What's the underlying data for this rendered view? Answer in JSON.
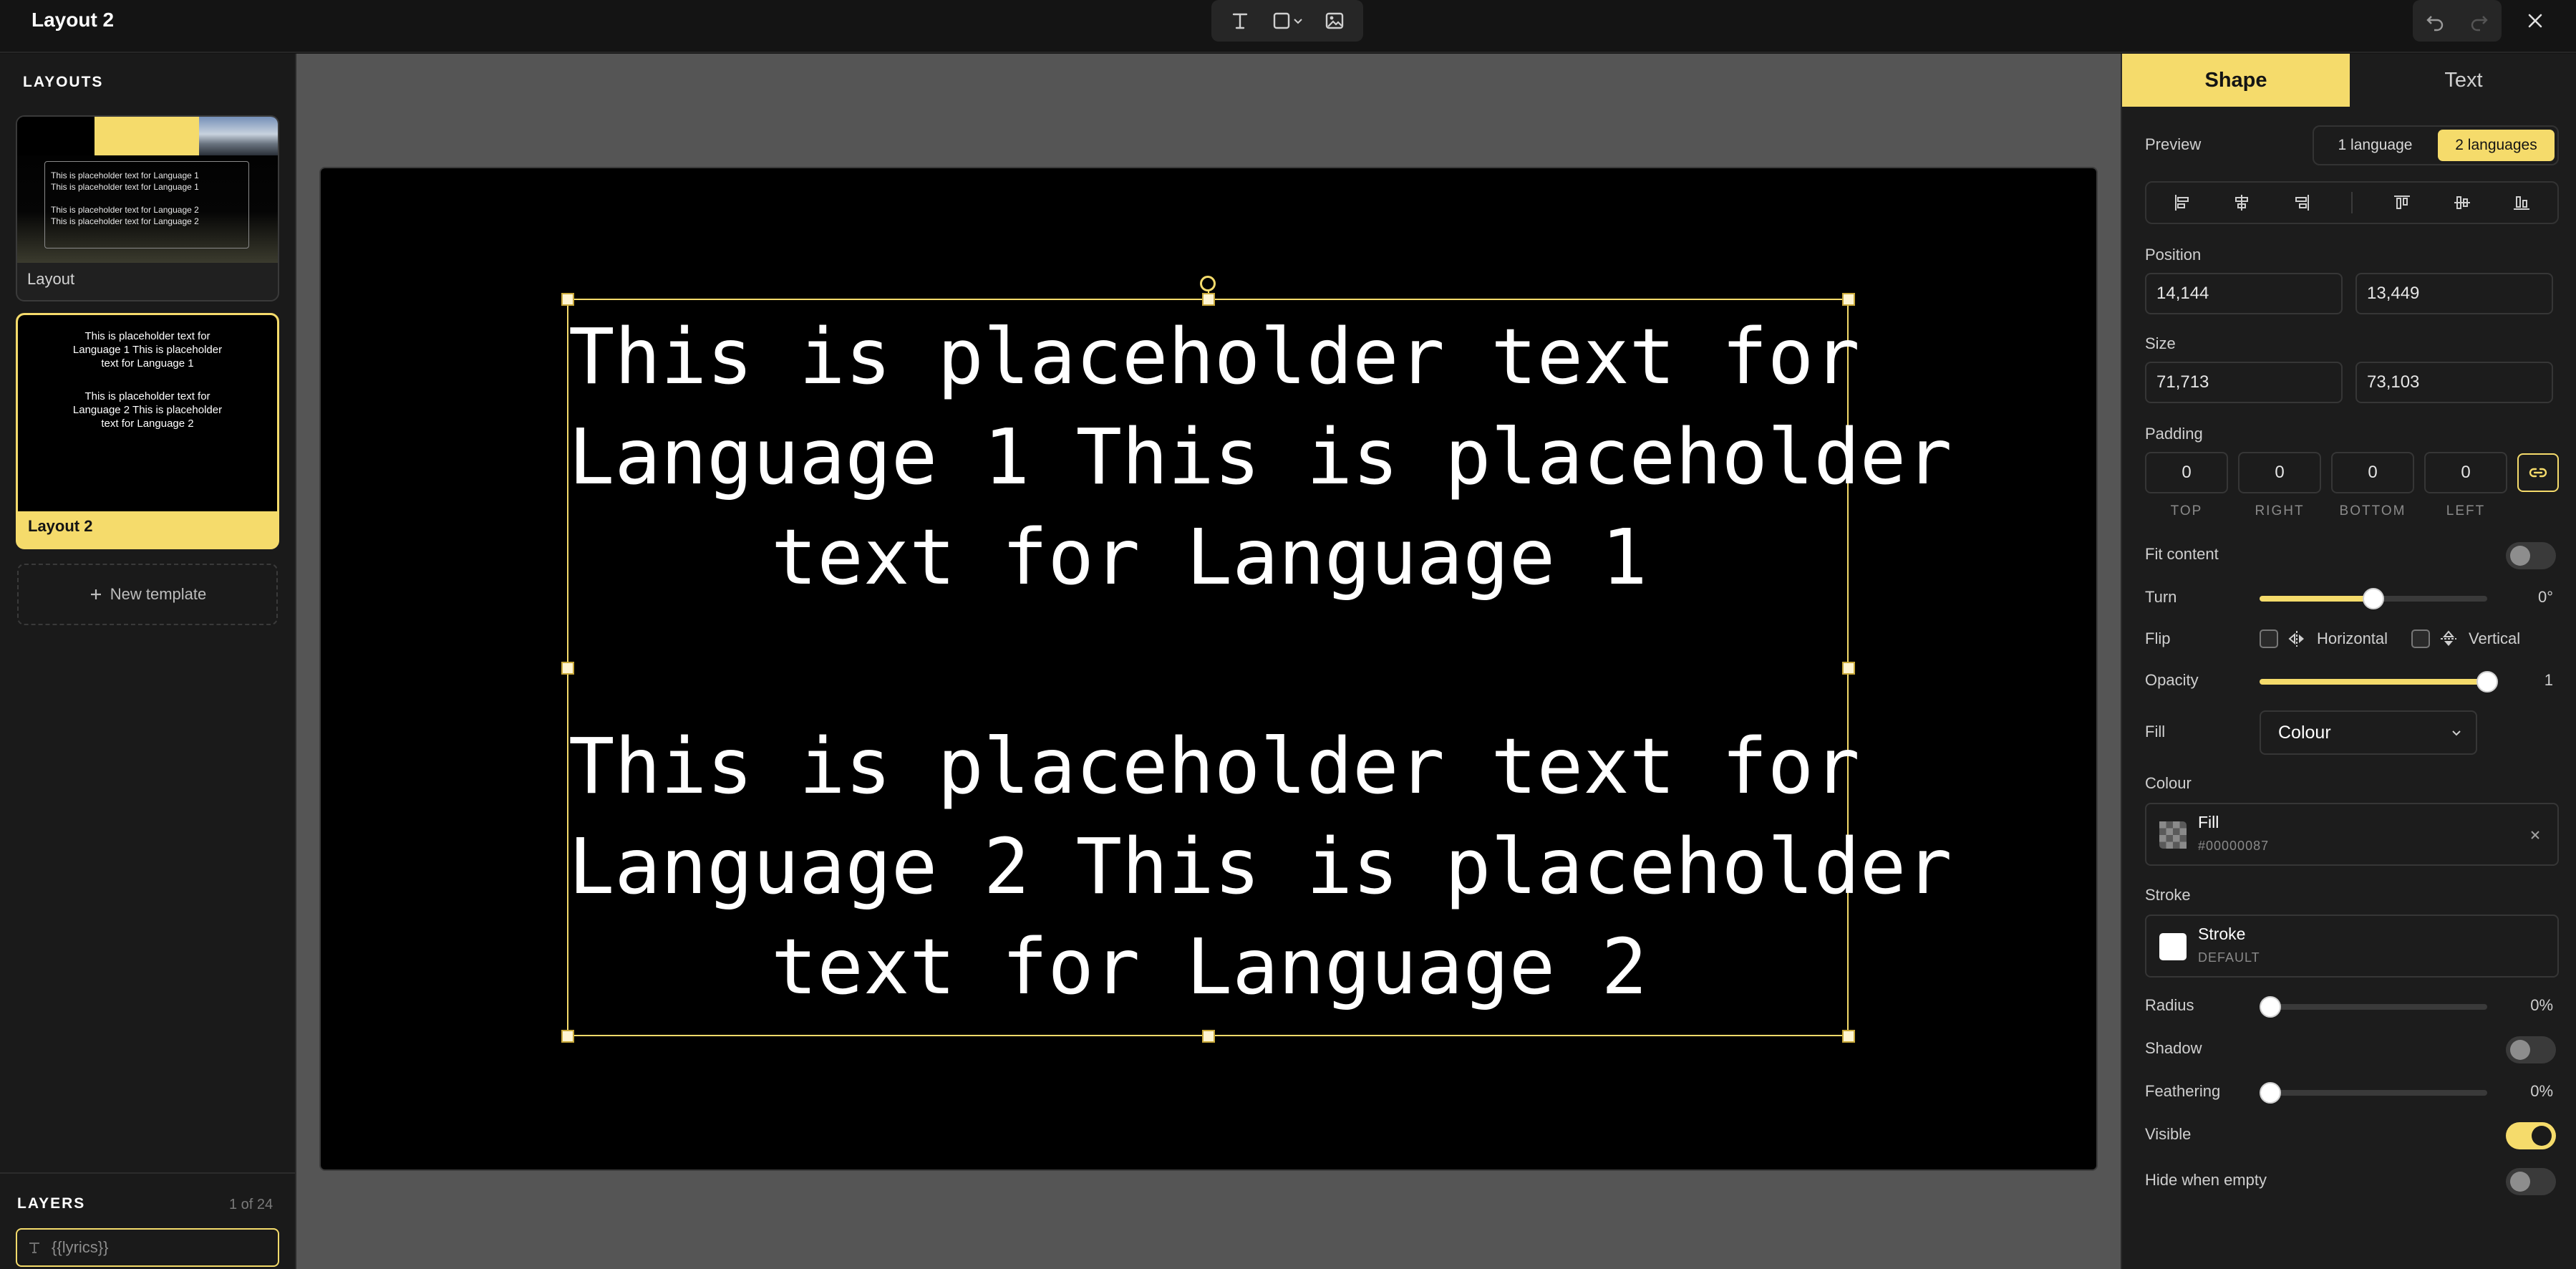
{
  "app": {
    "title": "Layout 2"
  },
  "toolbar": {
    "tools": [
      "text-tool-icon",
      "shape-tool-icon",
      "image-tool-icon"
    ],
    "history": [
      "undo-icon",
      "redo-icon"
    ]
  },
  "sidebar": {
    "layouts_title": "LAYOUTS",
    "templates": [
      {
        "name": "Layout",
        "preview_lines": [
          "This is placeholder text for Language 1",
          "This is placeholder text for Language 1",
          "This is placeholder text for Language 2",
          "This is placeholder text for Language 2"
        ]
      },
      {
        "name": "Layout 2",
        "preview_lines": [
          "This is placeholder text for",
          "Language 1 This is placeholder",
          "text for Language 1",
          "This is placeholder text for",
          "Language 2 This is placeholder",
          "text for Language 2"
        ]
      }
    ],
    "new_template": "New template",
    "layers_title": "LAYERS",
    "layers_count": "1 of 24",
    "layer_item": "{{lyrics}}"
  },
  "canvas": {
    "text_lines": [
      "This is placeholder text for",
      "Language 1 This is placeholder",
      "text for Language 1",
      "This is placeholder text for",
      "Language 2 This is placeholder",
      "text for Language 2"
    ]
  },
  "panel": {
    "tabs": [
      "Shape",
      "Text"
    ],
    "preview_label": "Preview",
    "preview_options": [
      "1 language",
      "2 languages"
    ],
    "preview_selected": "2 languages",
    "position_label": "Position",
    "position_x": "14,144",
    "position_y": "13,449",
    "size_label": "Size",
    "size_w": "71,713",
    "size_h": "73,103",
    "padding_label": "Padding",
    "padding": [
      {
        "value": "0",
        "caption": "TOP"
      },
      {
        "value": "0",
        "caption": "RIGHT"
      },
      {
        "value": "0",
        "caption": "BOTTOM"
      },
      {
        "value": "0",
        "caption": "LEFT"
      }
    ],
    "fit_content_label": "Fit content",
    "fit_content": false,
    "turn_label": "Turn",
    "turn_value": "0°",
    "turn_fraction": 0.5,
    "flip_label": "Flip",
    "flip_horizontal": "Horizontal",
    "flip_vertical": "Vertical",
    "opacity_label": "Opacity",
    "opacity_value": "1",
    "opacity_fraction": 1.0,
    "fill_label": "Fill",
    "fill_select": "Colour",
    "colour_label": "Colour",
    "colour_fill_title": "Fill",
    "colour_fill_hex": "#00000087",
    "stroke_label": "Stroke",
    "stroke_title": "Stroke",
    "stroke_sub": "DEFAULT",
    "radius_label": "Radius",
    "radius_value": "0%",
    "shadow_label": "Shadow",
    "shadow": false,
    "feathering_label": "Feathering",
    "feathering_value": "0%",
    "visible_label": "Visible",
    "visible": true,
    "hide_empty_label": "Hide when empty",
    "hide_empty": false
  },
  "colors": {
    "accent": "#f5db6b",
    "background": "#141414",
    "canvas_bg": "#555555",
    "stage": "#000000"
  }
}
